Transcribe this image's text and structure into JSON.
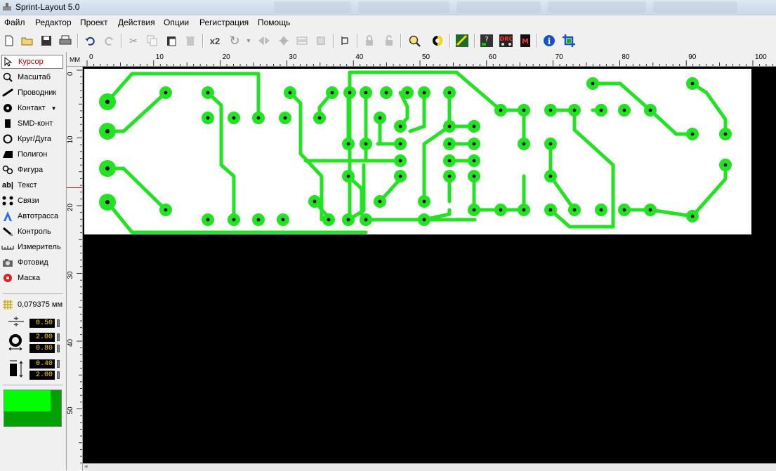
{
  "window": {
    "title": "Sprint-Layout 5.0"
  },
  "menu": {
    "items": [
      {
        "id": "file",
        "label": "Файл"
      },
      {
        "id": "editor",
        "label": "Редактор"
      },
      {
        "id": "project",
        "label": "Проект"
      },
      {
        "id": "actions",
        "label": "Действия"
      },
      {
        "id": "options",
        "label": "Опции"
      },
      {
        "id": "registration",
        "label": "Регистрация"
      },
      {
        "id": "help",
        "label": "Помощь"
      }
    ]
  },
  "toolbar": {
    "duplicate_label": "x2",
    "buttons": [
      {
        "id": "new",
        "icon": "new-file-icon"
      },
      {
        "id": "open",
        "icon": "open-folder-icon"
      },
      {
        "id": "save",
        "icon": "save-icon"
      },
      {
        "id": "print",
        "icon": "print-icon"
      },
      {
        "id": "undo",
        "icon": "undo-icon"
      },
      {
        "id": "redo",
        "icon": "redo-icon"
      },
      {
        "id": "cut",
        "icon": "cut-icon"
      },
      {
        "id": "copy",
        "icon": "copy-icon"
      },
      {
        "id": "paste",
        "icon": "paste-icon"
      },
      {
        "id": "delete",
        "icon": "delete-icon"
      },
      {
        "id": "duplicate",
        "icon": "duplicate-icon"
      },
      {
        "id": "rotate",
        "icon": "rotate-icon"
      },
      {
        "id": "mirror-h",
        "icon": "mirror-horizontal-icon"
      },
      {
        "id": "mirror-v",
        "icon": "mirror-vertical-icon"
      },
      {
        "id": "align",
        "icon": "align-icon"
      },
      {
        "id": "group",
        "icon": "group-icon"
      },
      {
        "id": "component",
        "icon": "component-icon"
      },
      {
        "id": "lock",
        "icon": "lock-icon"
      },
      {
        "id": "unlock",
        "icon": "unlock-icon"
      },
      {
        "id": "zoom",
        "icon": "zoom-icon"
      },
      {
        "id": "transparency",
        "icon": "transparency-icon"
      },
      {
        "id": "autoroute",
        "icon": "autoroute-icon"
      },
      {
        "id": "test",
        "icon": "test-icon"
      },
      {
        "id": "drc",
        "icon": "drc-icon"
      },
      {
        "id": "macro",
        "icon": "macro-icon"
      },
      {
        "id": "info",
        "icon": "info-icon"
      },
      {
        "id": "crop",
        "icon": "crop-icon"
      }
    ]
  },
  "tools": [
    {
      "id": "cursor",
      "label": "Курсор",
      "icon": "cursor-icon",
      "active": true
    },
    {
      "id": "zoom",
      "label": "Масштаб",
      "icon": "magnifier-icon",
      "active": false
    },
    {
      "id": "track",
      "label": "Проводник",
      "icon": "track-icon",
      "active": false
    },
    {
      "id": "pad",
      "label": "Контакт",
      "icon": "pad-icon",
      "active": false
    },
    {
      "id": "smd",
      "label": "SMD-конт",
      "icon": "smd-pad-icon",
      "active": false
    },
    {
      "id": "circle",
      "label": "Круг/Дуга",
      "icon": "circle-icon",
      "active": false
    },
    {
      "id": "polygon",
      "label": "Полигон",
      "icon": "polygon-icon",
      "active": false
    },
    {
      "id": "shapes",
      "label": "Фигура",
      "icon": "shapes-icon",
      "active": false
    },
    {
      "id": "text",
      "label": "Текст",
      "icon": "text-icon",
      "active": false
    },
    {
      "id": "connections",
      "label": "Связи",
      "icon": "connections-icon",
      "active": false
    },
    {
      "id": "autoroute",
      "label": "Автотрасса",
      "icon": "autoroute-icon",
      "active": false
    },
    {
      "id": "test",
      "label": "Контроль",
      "icon": "probe-icon",
      "active": false
    },
    {
      "id": "measure",
      "label": "Измеритель",
      "icon": "ruler-icon",
      "active": false
    },
    {
      "id": "photo",
      "label": "Фотовид",
      "icon": "camera-icon",
      "active": false
    },
    {
      "id": "mask",
      "label": "Маска",
      "icon": "mask-icon",
      "active": false
    }
  ],
  "properties": {
    "grid": "0,079375 мм",
    "track_width": "0.50",
    "pad_outer": "2.00",
    "pad_inner": "0.80",
    "smd_width": "0.40",
    "smd_height": "2.00"
  },
  "ruler": {
    "unit": "MM",
    "top_ticks": [
      "0",
      "10",
      "20",
      "30",
      "40",
      "50",
      "60",
      "70",
      "80",
      "90",
      "100"
    ],
    "left_ticks": [
      "0",
      "10",
      "20",
      "30",
      "40",
      "50"
    ]
  },
  "colors": {
    "canvas_bg": "#000000",
    "board": "#ffffff",
    "copper": "#21e321",
    "drill": "#000000",
    "layer_preview_light": "#00ff00",
    "layer_preview_dark": "#00a000"
  }
}
